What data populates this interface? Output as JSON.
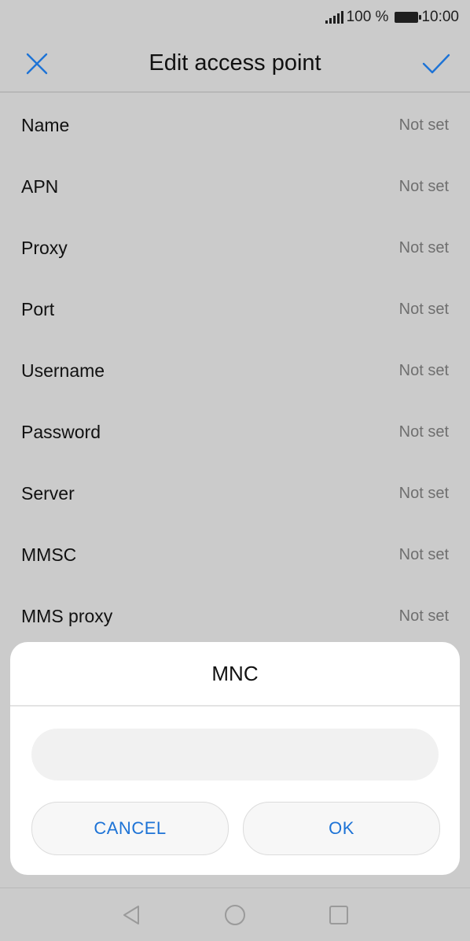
{
  "status_bar": {
    "battery_text": "100 %",
    "time": "10:00"
  },
  "toolbar": {
    "title": "Edit access point"
  },
  "fields": [
    {
      "label": "Name",
      "value": "Not set"
    },
    {
      "label": "APN",
      "value": "Not set"
    },
    {
      "label": "Proxy",
      "value": "Not set"
    },
    {
      "label": "Port",
      "value": "Not set"
    },
    {
      "label": "Username",
      "value": "Not set"
    },
    {
      "label": "Password",
      "value": "Not set"
    },
    {
      "label": "Server",
      "value": "Not set"
    },
    {
      "label": "MMSC",
      "value": "Not set"
    },
    {
      "label": "MMS proxy",
      "value": "Not set"
    }
  ],
  "dialog": {
    "title": "MNC",
    "input_value": "",
    "cancel_label": "CANCEL",
    "ok_label": "OK"
  },
  "colors": {
    "accent": "#1d73d6",
    "dim_background": "#cbcbcb",
    "dialog_background": "#ffffff"
  },
  "icons": {
    "toolbar_left": "close-icon",
    "toolbar_right": "check-icon",
    "nav": [
      "back-triangle-icon",
      "home-circle-icon",
      "recents-square-icon"
    ]
  }
}
